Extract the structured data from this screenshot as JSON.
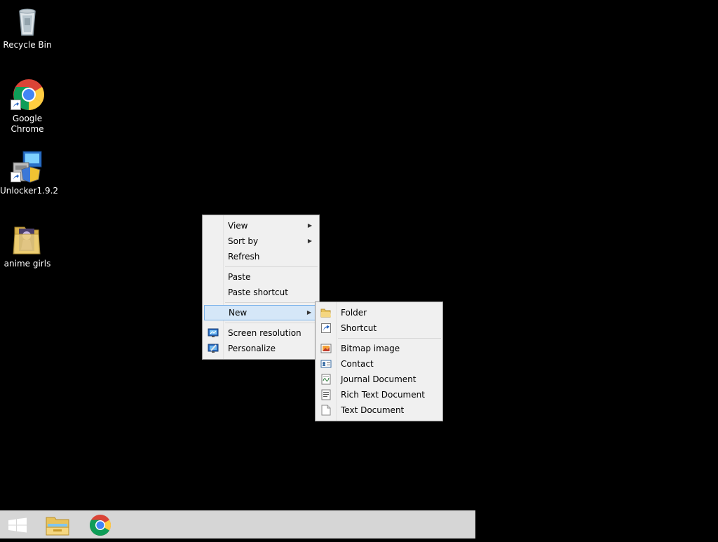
{
  "desktop": {
    "icons": [
      {
        "label": "Recycle Bin"
      },
      {
        "label": "Google Chrome"
      },
      {
        "label": "Unlocker1.9.2"
      },
      {
        "label": "anime girls"
      }
    ]
  },
  "context_menu": {
    "items": [
      {
        "label": "View",
        "submenu": true
      },
      {
        "label": "Sort by",
        "submenu": true
      },
      {
        "label": "Refresh"
      },
      {
        "label": "Paste"
      },
      {
        "label": "Paste shortcut"
      },
      {
        "label": "New",
        "submenu": true,
        "highlighted": true
      },
      {
        "label": "Screen resolution",
        "icon": "screen-resolution-icon"
      },
      {
        "label": "Personalize",
        "icon": "personalize-icon"
      }
    ]
  },
  "new_submenu": {
    "items": [
      {
        "label": "Folder",
        "icon": "folder-icon"
      },
      {
        "label": "Shortcut",
        "icon": "shortcut-icon"
      },
      {
        "label": "Bitmap image",
        "icon": "bitmap-icon"
      },
      {
        "label": "Contact",
        "icon": "contact-icon"
      },
      {
        "label": "Journal Document",
        "icon": "journal-icon"
      },
      {
        "label": "Rich Text Document",
        "icon": "rich-text-icon"
      },
      {
        "label": "Text Document",
        "icon": "text-document-icon"
      }
    ]
  },
  "taskbar": {
    "buttons": [
      {
        "icon": "windows-start-icon"
      },
      {
        "icon": "file-explorer-icon"
      },
      {
        "icon": "chrome-icon"
      }
    ]
  },
  "colors": {
    "desktop_bg": "#000000",
    "menu_bg": "#f0f0f0",
    "menu_highlight": "#d5e7f8",
    "menu_highlight_border": "#7eb4ea",
    "taskbar_bg": "#d6d6d6"
  }
}
